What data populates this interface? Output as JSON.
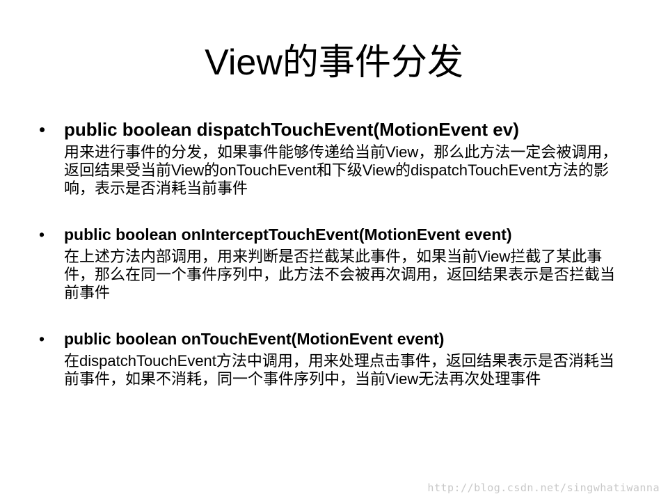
{
  "slide": {
    "title": "View的事件分发",
    "bullets": [
      {
        "marker": "•",
        "signature": "public boolean dispatchTouchEvent(MotionEvent ev)",
        "description": "用来进行事件的分发，如果事件能够传递给当前View，那么此方法一定会被调用，返回结果受当前View的onTouchEvent和下级View的dispatchTouchEvent方法的影响，表示是否消耗当前事件"
      },
      {
        "marker": "•",
        "signature": "public boolean onInterceptTouchEvent(MotionEvent event)",
        "description": "在上述方法内部调用，用来判断是否拦截某此事件，如果当前View拦截了某此事件，那么在同一个事件序列中，此方法不会被再次调用，返回结果表示是否拦截当前事件"
      },
      {
        "marker": "•",
        "signature": "public boolean onTouchEvent(MotionEvent event)",
        "description": "在dispatchTouchEvent方法中调用，用来处理点击事件，返回结果表示是否消耗当前事件，如果不消耗，同一个事件序列中，当前View无法再次处理事件"
      }
    ],
    "watermark": "http://blog.csdn.net/singwhatiwanna"
  }
}
